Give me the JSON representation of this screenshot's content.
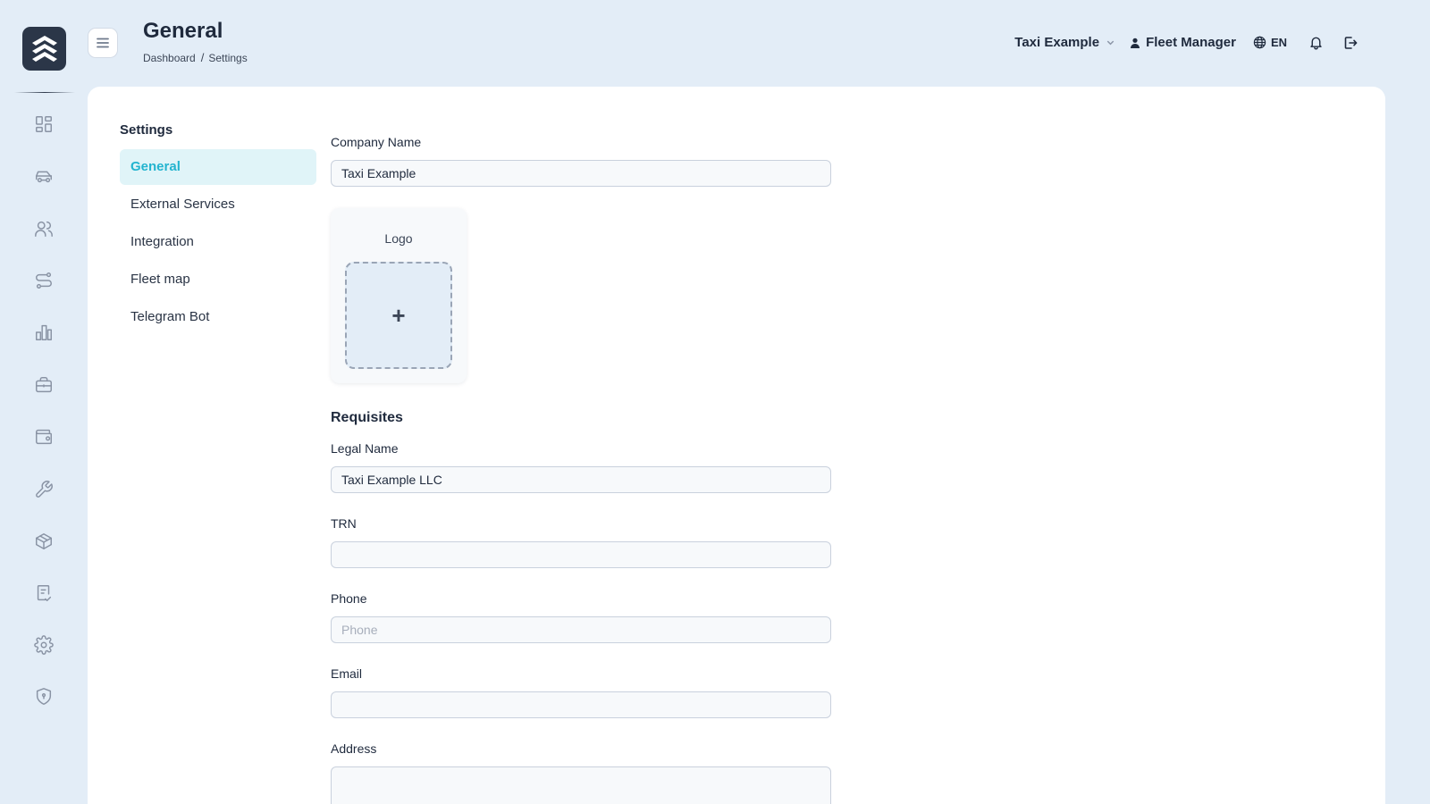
{
  "header": {
    "title": "General",
    "breadcrumb": [
      "Dashboard",
      "Settings"
    ],
    "breadcrumb_separator": "/",
    "company": "Taxi Example",
    "user_role": "Fleet Manager",
    "language": "EN"
  },
  "rail": {
    "icons": [
      "dashboard-icon",
      "car-icon",
      "users-icon",
      "route-icon",
      "bar-chart-icon",
      "briefcase-icon",
      "wallet-icon",
      "wrench-icon",
      "box-icon",
      "clipboard-check-icon",
      "gear-icon",
      "shield-icon"
    ]
  },
  "settings": {
    "heading": "Settings",
    "nav": [
      {
        "label": "General",
        "active": true
      },
      {
        "label": "External Services",
        "active": false
      },
      {
        "label": "Integration",
        "active": false
      },
      {
        "label": "Fleet map",
        "active": false
      },
      {
        "label": "Telegram Bot",
        "active": false
      }
    ]
  },
  "form": {
    "company_name": {
      "label": "Company Name",
      "value": "Taxi Example"
    },
    "logo": {
      "label": "Logo",
      "add_symbol": "+"
    },
    "requisites_title": "Requisites",
    "legal_name": {
      "label": "Legal Name",
      "value": "Taxi Example LLC"
    },
    "trn": {
      "label": "TRN",
      "value": ""
    },
    "phone": {
      "label": "Phone",
      "value": "",
      "placeholder": "Phone"
    },
    "email": {
      "label": "Email",
      "value": ""
    },
    "address": {
      "label": "Address",
      "value": ""
    }
  },
  "colors": {
    "background": "#e3edf7",
    "accent": "#23b4cf",
    "active_nav_bg": "#e0f4f8",
    "logo_bg": "#2b3648"
  }
}
